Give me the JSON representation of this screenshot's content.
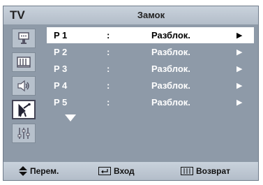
{
  "header": {
    "tv_label": "TV",
    "title": "Замок"
  },
  "sidebar": {
    "icons": [
      "input-icon",
      "picture-icon",
      "sound-icon",
      "channel-icon",
      "setup-icon"
    ],
    "active_index": 3
  },
  "rows": [
    {
      "channel": "P 1",
      "colon": ":",
      "status": "Разблок.",
      "arrow": "▶",
      "selected": true
    },
    {
      "channel": "P 2",
      "colon": ":",
      "status": "Разблок.",
      "arrow": "▶",
      "selected": false
    },
    {
      "channel": "P 3",
      "colon": ":",
      "status": "Разблок.",
      "arrow": "▶",
      "selected": false
    },
    {
      "channel": "P 4",
      "colon": ":",
      "status": "Разблок.",
      "arrow": "▶",
      "selected": false
    },
    {
      "channel": "P 5",
      "colon": ":",
      "status": "Разблок.",
      "arrow": "▶",
      "selected": false
    }
  ],
  "footer": {
    "move_label": "Перем.",
    "enter_label": "Вход",
    "return_label": "Возврат"
  },
  "colors": {
    "panel": "#8e9aa8",
    "header": "#c2cbd6",
    "selected_row": "#ffffff"
  }
}
